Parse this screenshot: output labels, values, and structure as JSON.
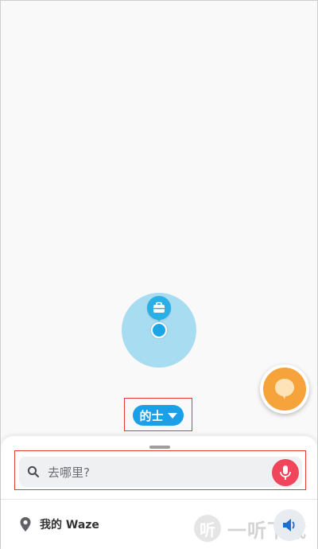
{
  "map": {
    "vehicle_selector": {
      "label": "的士"
    }
  },
  "search": {
    "placeholder": "去哪里?"
  },
  "bottom_bar": {
    "my_waze_label": "我的 Waze"
  },
  "watermark": {
    "logo_char": "听",
    "text": "一听下载"
  },
  "colors": {
    "accent_blue": "#1a9fe8",
    "fab_orange": "#f5a33a",
    "mic_red": "#f0455a",
    "highlight_red": "#e53935"
  },
  "icons": {
    "marker": "briefcase-icon",
    "fab": "report-bubble-icon",
    "search": "search-icon",
    "mic": "microphone-icon",
    "my_waze": "location-pin-icon",
    "sound": "speaker-icon"
  }
}
